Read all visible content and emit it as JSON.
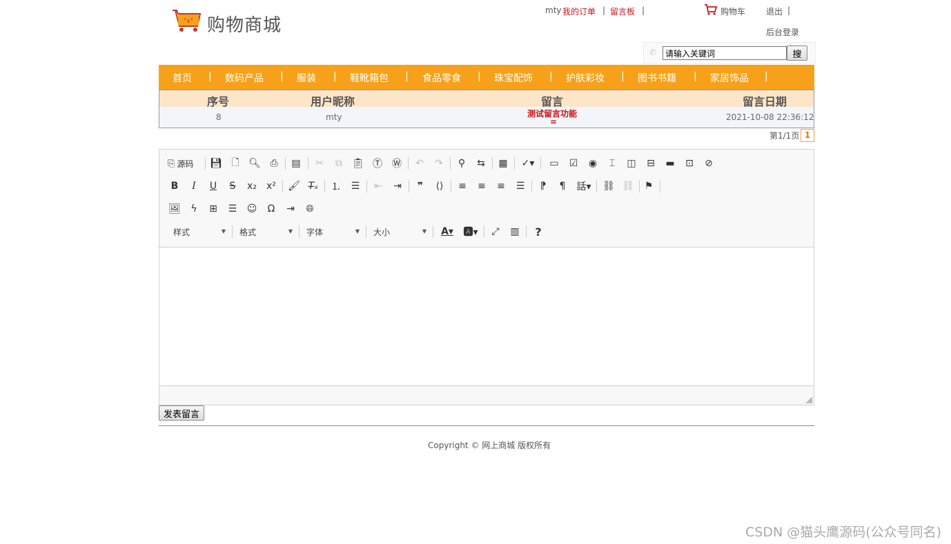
{
  "site": {
    "title": "购物商城"
  },
  "topbar": {
    "username": "mty",
    "my_orders": "我的订单",
    "message_board": "留言板",
    "cart": "购物车",
    "logout": "退出",
    "admin_login": "后台登录",
    "separator": "|"
  },
  "search": {
    "value": "请输入关键词",
    "button": "搜"
  },
  "nav": {
    "items": [
      "首页",
      "数码产品",
      "服装",
      "鞋靴箱包",
      "食品零食",
      "珠宝配饰",
      "护肤彩妆",
      "图书书籍",
      "家居饰品"
    ],
    "separator": "|"
  },
  "table": {
    "headers": [
      "序号",
      "用户昵称",
      "留言",
      "留言日期"
    ],
    "rows": [
      {
        "id": "8",
        "nickname": "mty",
        "message": "测试留言功能",
        "message_line2": "=",
        "date": "2021-10-08 22:36:12"
      }
    ]
  },
  "pager": {
    "text": "第1/1页",
    "current": "1"
  },
  "editor": {
    "source_label": "源码",
    "combos": [
      "样式",
      "格式",
      "字体",
      "大小"
    ]
  },
  "submit_button": "发表留言",
  "footer": {
    "copyright": "Copyright © 网上商城 版权所有"
  },
  "watermark": "CSDN @猫头鹰源码(公众号同名)",
  "colors": {
    "nav": "#f7a11a",
    "header_row": "#fde6c8",
    "link_red": "#c8161d"
  }
}
